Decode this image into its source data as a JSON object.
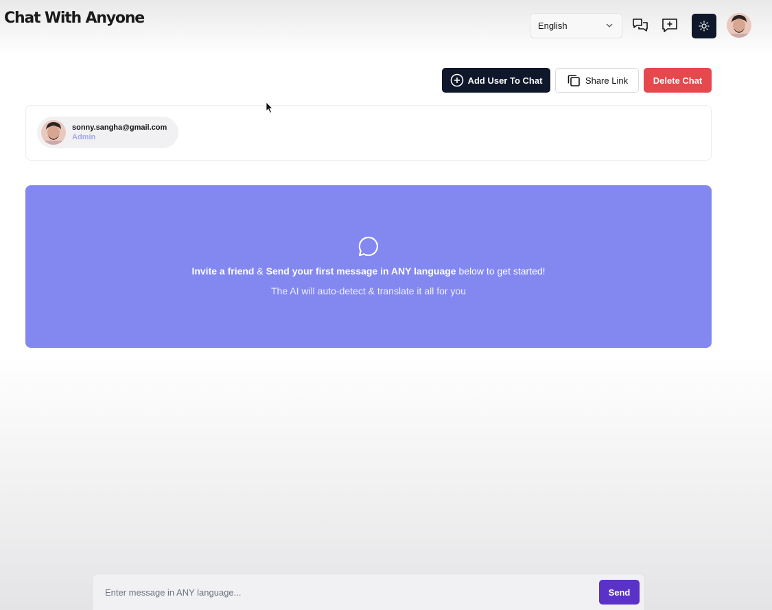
{
  "header": {
    "logo": "Chat With Anyone",
    "language_selected": "English",
    "icons": [
      "chat-list-icon",
      "new-chat-icon",
      "sun-icon"
    ]
  },
  "actions": {
    "add_user_label": "Add User To Chat",
    "share_label": "Share Link",
    "delete_label": "Delete Chat"
  },
  "members": [
    {
      "email": "sonny.sangha@gmail.com",
      "role": "Admin"
    }
  ],
  "banner": {
    "part1": "Invite a friend",
    "amp": " & ",
    "part2": "Send your first message in ANY language",
    "part3": " below to get started!",
    "line2": "The AI will auto-detect & translate it all for you"
  },
  "composer": {
    "placeholder": "Enter message in ANY language...",
    "send_label": "Send"
  },
  "colors": {
    "primary_dark": "#0f172a",
    "delete": "#e5484d",
    "banner": "#8388f0",
    "send": "#5b32c7"
  }
}
